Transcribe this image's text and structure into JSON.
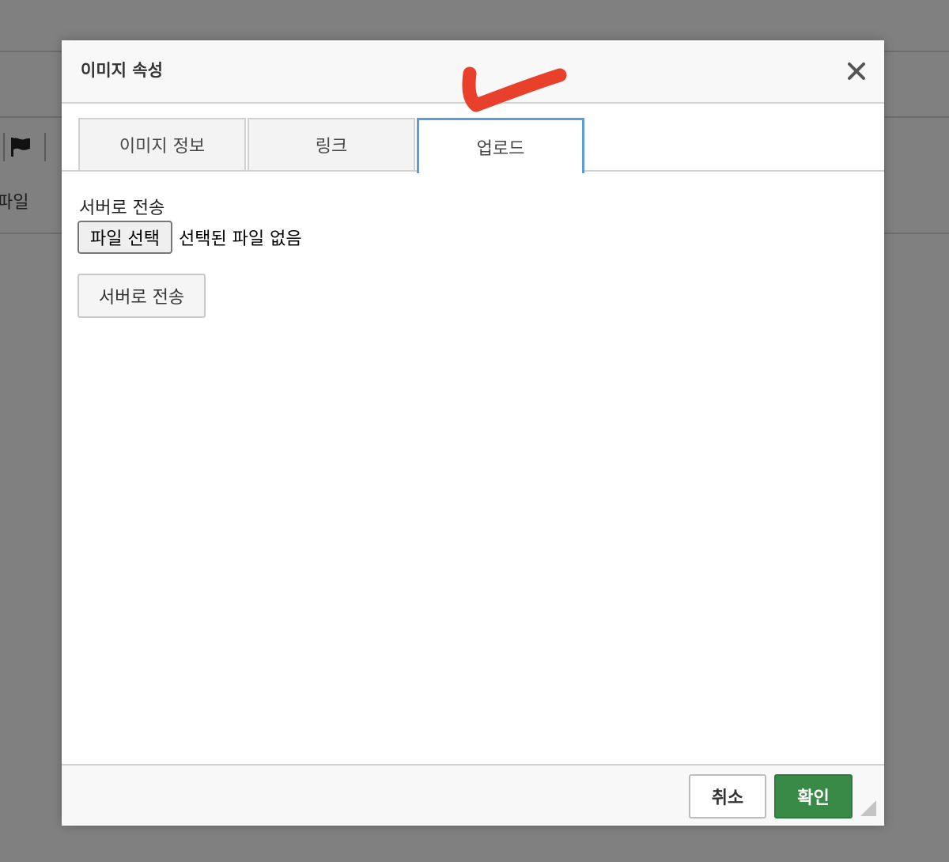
{
  "background": {
    "partial_text": "파일"
  },
  "dialog": {
    "title": "이미지 속성",
    "tabs": [
      {
        "label": "이미지 정보",
        "active": false
      },
      {
        "label": "링크",
        "active": false
      },
      {
        "label": "업로드",
        "active": true
      }
    ],
    "upload": {
      "section_label": "서버로 전송",
      "file_choose_label": "파일 선택",
      "file_status": "선택된 파일 없음",
      "send_button_label": "서버로 전송"
    },
    "footer": {
      "cancel_label": "취소",
      "ok_label": "확인"
    }
  },
  "colors": {
    "active_tab_border": "#5b9dd9",
    "ok_button": "#3a8a47",
    "annotation": "#e8402a"
  },
  "icons": {
    "close": "close-icon",
    "flag": "flag-icon",
    "resize": "resize-handle-icon",
    "annotation": "checkmark-annotation"
  }
}
